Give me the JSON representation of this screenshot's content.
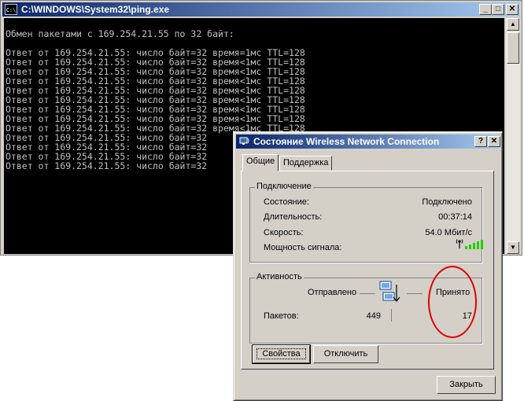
{
  "console": {
    "title": "C:\\WINDOWS\\System32\\ping.exe",
    "icon_text": "C:\\",
    "lines": [
      "Обмен пакетами с 169.254.21.55 по 32 байт:",
      "",
      "Ответ от 169.254.21.55: число байт=32 время=1мс TTL=128",
      "Ответ от 169.254.21.55: число байт=32 время<1мс TTL=128",
      "Ответ от 169.254.21.55: число байт=32 время<1мс TTL=128",
      "Ответ от 169.254.21.55: число байт=32 время<1мс TTL=128",
      "Ответ от 169.254.21.55: число байт=32 время<1мс TTL=128",
      "Ответ от 169.254.21.55: число байт=32 время<1мс TTL=128",
      "Ответ от 169.254.21.55: число байт=32 время<1мс TTL=128",
      "Ответ от 169.254.21.55: число байт=32 время<1мс TTL=128",
      "Ответ от 169.254.21.55: число байт=32 время<1мс TTL=128",
      "Ответ от 169.254.21.55: число байт=32",
      "Ответ от 169.254.21.55: число байт=32",
      "Ответ от 169.254.21.55: число байт=32",
      "Ответ от 169.254.21.55: число байт=32"
    ],
    "btn_min": "_",
    "btn_max": "□",
    "btn_close": "✕",
    "scroll_up": "▲",
    "scroll_down": "▼"
  },
  "dialog": {
    "title": "Состояние Wireless Network Connection",
    "btn_help": "?",
    "btn_close": "✕",
    "tabs": [
      "Общие",
      "Поддержка"
    ],
    "connection": {
      "group_title": "Подключение",
      "status_label": "Состояние:",
      "status_value": "Подключено",
      "duration_label": "Длительность:",
      "duration_value": "00:37:14",
      "speed_label": "Скорость:",
      "speed_value": "54.0 Мбит/с",
      "signal_label": "Мощность сигнала:",
      "signal_bars": 5
    },
    "activity": {
      "group_title": "Активность",
      "sent_label": "Отправлено",
      "received_label": "Принято",
      "packets_label": "Пакетов:",
      "packets_sent": "449",
      "packets_received": "17"
    },
    "buttons": {
      "properties": "Свойства",
      "disable": "Отключить",
      "close": "Закрыть"
    }
  },
  "colors": {
    "annotation": "#e00000",
    "signal": "#1fd000",
    "titlebar": "#0a246a"
  }
}
